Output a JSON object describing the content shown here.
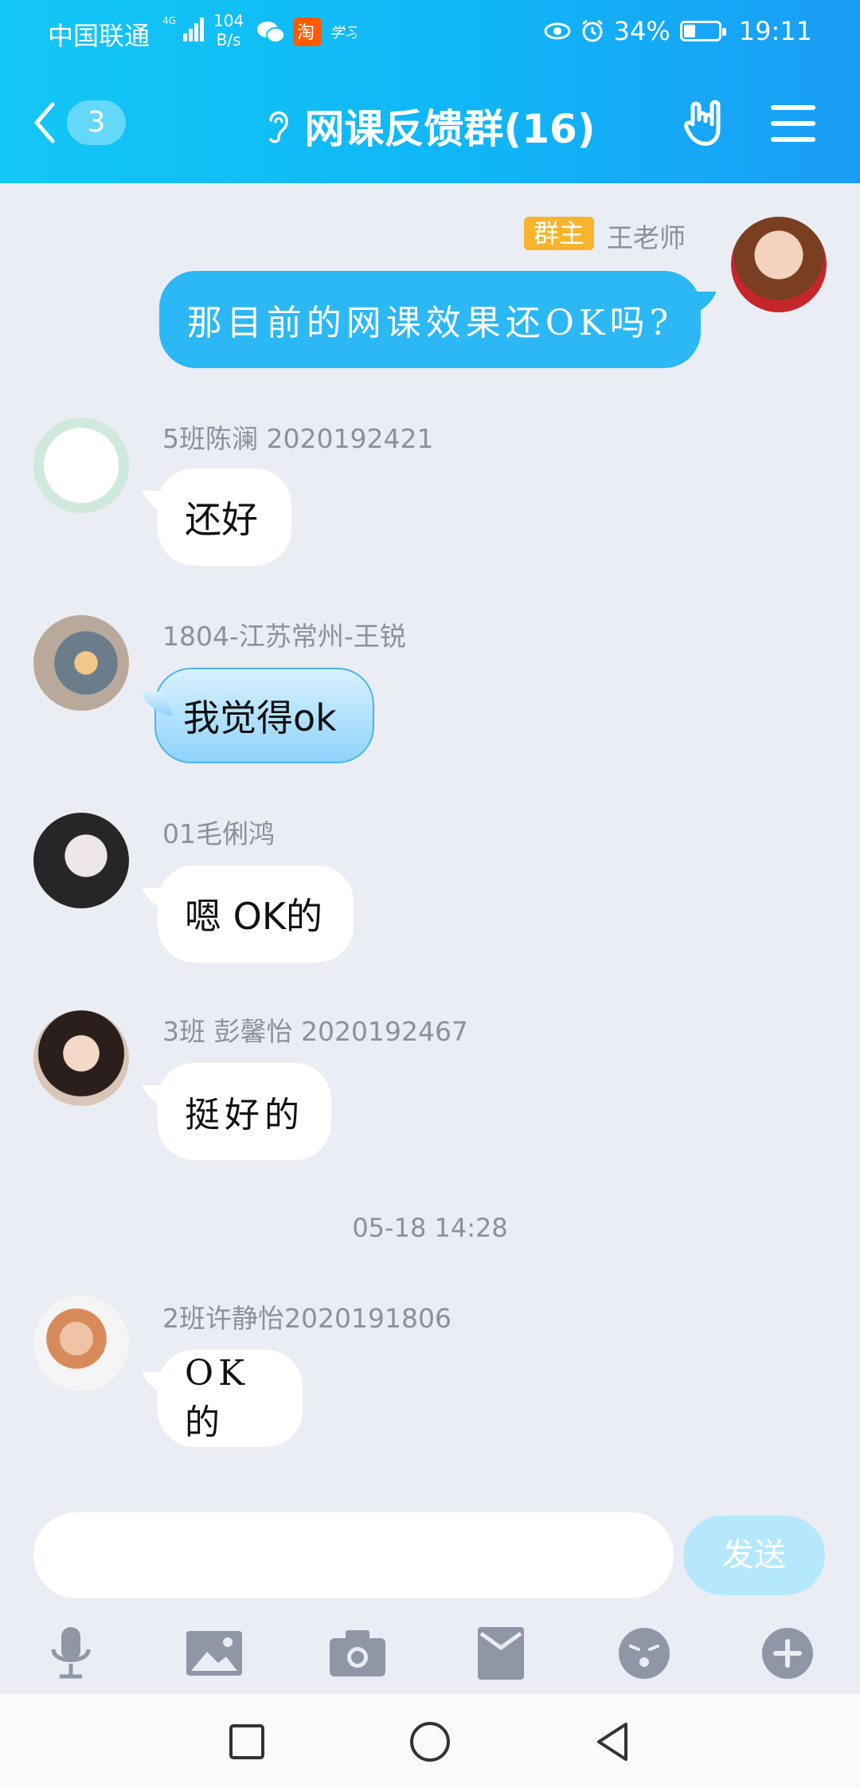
{
  "status_bar": {
    "carrier": "中国联通",
    "net_type": "4G",
    "speed_value": "104",
    "speed_unit": "B/s",
    "battery": "34%",
    "battery_level": 0.34,
    "time": "19:11",
    "app_icons": [
      "wechat-icon",
      "taobao-icon",
      "xuexi-icon"
    ]
  },
  "header": {
    "back_count": "3",
    "title": "网课反馈群(16)"
  },
  "messages": [
    {
      "sender": "王老师",
      "badge": "群主",
      "text": "那目前的网课效果还OK吗?",
      "side": "right"
    },
    {
      "sender": "5班陈澜 2020192421",
      "text": "还好",
      "side": "left"
    },
    {
      "sender": "1804-江苏常州-王锐",
      "text": "我觉得ok",
      "side": "left"
    },
    {
      "sender": "01毛俐鸿",
      "text": "嗯 OK的",
      "side": "left"
    },
    {
      "sender": "3班 彭馨怡 2020192467",
      "text": "挺好的",
      "side": "left"
    },
    {
      "sender": "2班许静怡2020191806",
      "text": "OK的",
      "side": "left"
    }
  ],
  "timestamp": "05-18 14:28",
  "input": {
    "value": "",
    "send_label": "发送"
  },
  "toolbar": [
    "voice-icon",
    "image-icon",
    "camera-icon",
    "red-packet-icon",
    "emoji-icon",
    "plus-icon"
  ],
  "colors": {
    "header": "#13c7f6",
    "bubble_self": "#2bb8f5",
    "background": "#eaedf4",
    "owner_badge": "#f7b42c"
  }
}
